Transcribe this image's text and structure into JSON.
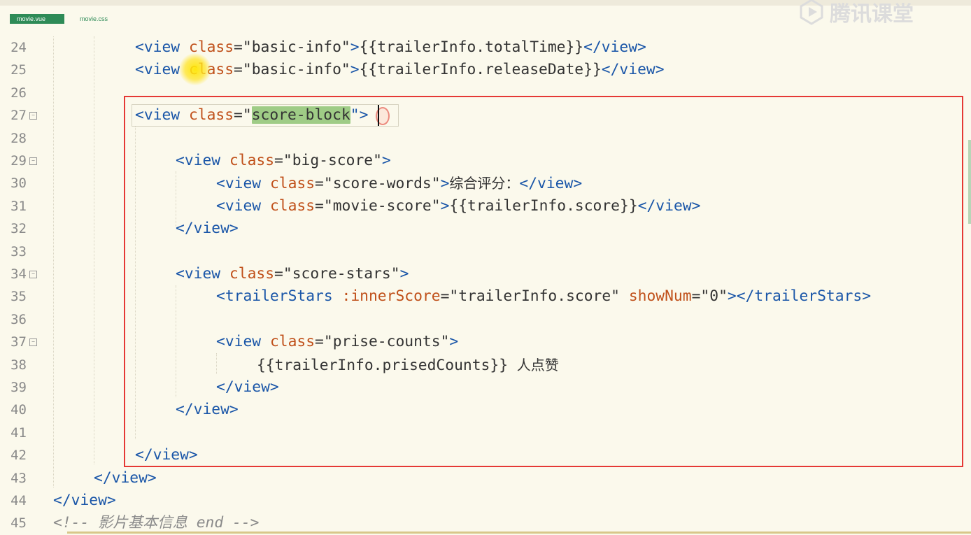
{
  "tabs": [
    {
      "label": "movie.vue",
      "active": true
    },
    {
      "label": "movie.css",
      "active": false
    }
  ],
  "watermark": {
    "text": "腾讯课堂",
    "icon": "play-logo-icon"
  },
  "line_numbers": [
    "24",
    "25",
    "26",
    "27",
    "28",
    "29",
    "30",
    "31",
    "32",
    "33",
    "34",
    "35",
    "36",
    "37",
    "38",
    "39",
    "40",
    "41",
    "42",
    "43",
    "44",
    "45"
  ],
  "code": {
    "l24": {
      "open": "<view ",
      "attr": "class",
      "eq": "=",
      "val": "\"basic-info\"",
      "close": ">",
      "expr": "{{trailerInfo.totalTime}}",
      "end": "</view>"
    },
    "l25": {
      "open": "<view ",
      "attr": "class",
      "eq": "=",
      "val": "\"basic-info\"",
      "close": ">",
      "expr": "{{trailerInfo.releaseDate}}",
      "end": "</view>"
    },
    "l27": {
      "open": "<view ",
      "attr": "class",
      "eq": "=\"",
      "val": "score-block",
      "close": "\">"
    },
    "l29": {
      "open": "<view ",
      "attr": "class",
      "eq": "=",
      "val": "\"big-score\"",
      "close": ">"
    },
    "l30": {
      "open": "<view ",
      "attr": "class",
      "eq": "=",
      "val": "\"score-words\"",
      "close": ">",
      "text": "综合评分：",
      "end": "</view>"
    },
    "l31": {
      "open": "<view ",
      "attr": "class",
      "eq": "=",
      "val": "\"movie-score\"",
      "close": ">",
      "expr": "{{trailerInfo.score}}",
      "end": "</view>"
    },
    "l32": {
      "end": "</view>"
    },
    "l34": {
      "open": "<view ",
      "attr": "class",
      "eq": "=",
      "val": "\"score-stars\"",
      "close": ">"
    },
    "l35": {
      "open": "<trailerStars ",
      "attr1": ":innerScore",
      "eq1": "=",
      "val1": "\"trailerInfo.score\" ",
      "attr2": "showNum",
      "eq2": "=",
      "val2": "\"0\"",
      "close": ">",
      "end": "</trailerStars>"
    },
    "l37": {
      "open": "<view ",
      "attr": "class",
      "eq": "=",
      "val": "\"prise-counts\"",
      "close": ">"
    },
    "l38": {
      "expr": "{{trailerInfo.prisedCounts}}",
      "text": "  人点赞"
    },
    "l39": {
      "end": "</view>"
    },
    "l40": {
      "end": "</view>"
    },
    "l42": {
      "end": "</view>"
    },
    "l43": {
      "end": "</view>"
    },
    "l44": {
      "end": "</view>"
    },
    "l45": {
      "comment": "<!-- 影片基本信息 end -->"
    }
  },
  "colors": {
    "tag": "#1a56a8",
    "attr": "#c0501a",
    "highlight": "#9fcc86",
    "annotation_box": "#e53935",
    "tab_active": "#2e8b57"
  }
}
